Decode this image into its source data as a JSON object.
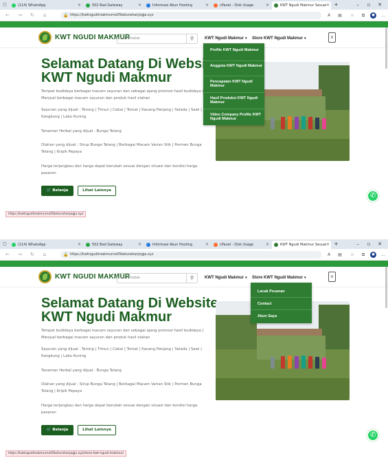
{
  "colors": {
    "brand_green": "#1b5e20",
    "accent_green": "#2b9a3b",
    "menu_green": "#2e7d32",
    "whatsapp": "#25d366"
  },
  "browser": {
    "tabs": [
      {
        "label": "(114) WhatsApp",
        "icon": "whatsapp-icon",
        "color": "#25d366"
      },
      {
        "label": "502 Bad Gateway",
        "icon": "globe-icon",
        "color": "#27a844"
      },
      {
        "label": "Informasi Akun Hosting",
        "icon": "hosting-icon",
        "color": "#2a7de1"
      },
      {
        "label": "cPanel - Disk Usage",
        "icon": "cpanel-icon",
        "color": "#ff6c2c"
      },
      {
        "label": "KWT Ngudi Makmur Sesuai",
        "icon": "site-icon",
        "color": "#2e7d32"
      }
    ],
    "url": "https://kwtngudimakmurno05kelurahanjogja.xyz"
  },
  "site": {
    "brand": "KWT NGUDI MAKMUR",
    "search_placeholder": "Cari Produk",
    "menu_1": "KWT Ngudi Makmur",
    "menu_2": "Store KWT Ngudi Makmur",
    "hero_title_1": "Selamat Datang Di Website",
    "hero_title_2": "KWT Ngudi Makmur",
    "p1": "Tempat budidaya berbagai macam sayuran dan sebagai ajang promosi hasil budidaya | Menjual berbagai macam sayuran dan produk hasil olahan",
    "p2": "Sayuran yang dijual : Terong | Timun | Cabai | Tomat | Kacang Panjang | Selada | Sawi | Kangkung | Labu Kuning",
    "p3": "Tanaman Herbal yang dijual : Bunga Telang",
    "p4": "Olahan yang dijual : Sirup Bunga Telang | Berbagai Macam Varian Stik | Permen Bunga Telang | Kripik Pepaya",
    "p5": "Harga terjangkau dan harga dapat berubah sesuai dengan situasi dan kondisi harga pasaran",
    "btn_belanja": "Belanja",
    "btn_lihat": "Lihat Lainnya"
  },
  "shot1": {
    "dropdown": [
      "Profile KWT Ngudi Makmur",
      "Anggota KWT Ngudi Makmur",
      "Pencapaian KWT Ngudi Makmur",
      "Hasil Produksi KWT Ngudi Makmur",
      "Video Company Profile KWT Ngudi Makmur"
    ],
    "status_url": "https://kwtngudimakmurno05kelurahanjogja.xyz"
  },
  "shot2": {
    "dropdown": [
      "Lacak Pesanan",
      "Contact",
      "Akun Saya"
    ],
    "status_url": "https://kwtngudimakmurno05kelurahanjogja.xyz/store-kwt-ngudi-makmur/"
  }
}
